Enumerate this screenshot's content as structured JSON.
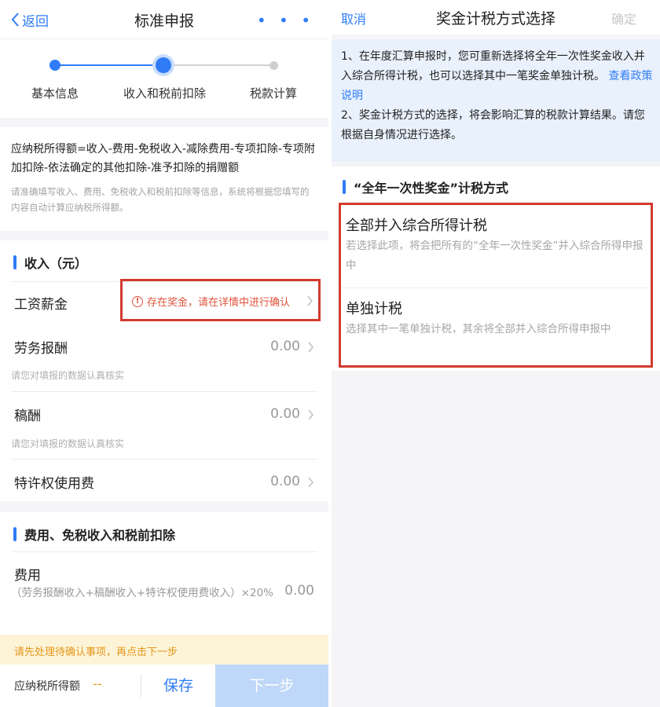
{
  "left": {
    "header": {
      "back_label": "返回",
      "title": "标准申报",
      "more_label": "• • •"
    },
    "steps": [
      "基本信息",
      "收入和税前扣除",
      "税款计算"
    ],
    "formula": {
      "text": "应纳税所得额=收入-费用-免税收入-减除费用-专项扣除-专项附加扣除-依法确定的其他扣除-准予扣除的捐赠额",
      "hint": "请准确填写收入、费用、免税收入和税前扣除等信息，系统将根据您填写的内容自动计算应纳税所得额。"
    },
    "income": {
      "title": "收入（元）",
      "rows": [
        {
          "label": "工资薪金",
          "warning": "存在奖金，请在详情中进行确认"
        },
        {
          "label": "劳务报酬",
          "value": "0.00",
          "hint": "请您对填报的数据认真核实"
        },
        {
          "label": "稿酬",
          "value": "0.00",
          "hint": "请您对填报的数据认真核实"
        },
        {
          "label": "特许权使用费",
          "value": "0.00"
        }
      ]
    },
    "expense": {
      "title": "费用、免税收入和税前扣除",
      "label": "费用",
      "formula": "（劳务报酬收入+稿酬收入+特许权使用费收入）×20%",
      "value": "0.00"
    },
    "notice": "请先处理待确认事项，再点击下一步",
    "bottom": {
      "tax_label": "应纳税所得额",
      "tax_value": "--",
      "save": "保存",
      "next": "下一步"
    }
  },
  "right": {
    "header": {
      "cancel": "取消",
      "title": "奖金计税方式选择",
      "confirm": "确定"
    },
    "info": {
      "p1": "1、在年度汇算申报时，您可重新选择将全年一次性奖金收入并入综合所得计税，也可以选择其中一笔奖金单独计税。",
      "p1_link": "查看政策说明",
      "p2": "2、奖金计税方式的选择，将会影响汇算的税款计算结果。请您根据自身情况进行选择。"
    },
    "section_title": "“全年一次性奖金”计税方式",
    "options": [
      {
        "title": "全部并入综合所得计税",
        "desc": "若选择此项，将会把所有的“全年一次性奖金”并入综合所得申报中"
      },
      {
        "title": "单独计税",
        "desc": "选择其中一笔单独计税，其余将全部并入综合所得申报中"
      }
    ]
  },
  "colors": {
    "accent": "#2f7cf6",
    "warning": "#e0523b",
    "highlight_border": "#d23b2f",
    "notice": "#e5961a"
  },
  "icons": {
    "back": "chevron-left-icon",
    "row_arrow": "chevron-right-icon",
    "warning": "exclamation-circle-icon"
  }
}
